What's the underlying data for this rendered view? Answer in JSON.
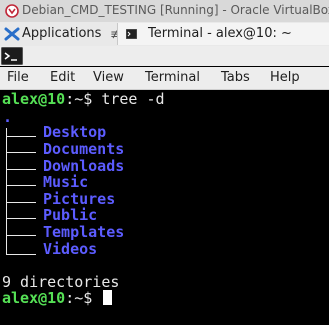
{
  "host_window": {
    "title": "Debian_CMD_TESTING [Running] - Oracle VirtualBox",
    "icon": "virtualbox-icon"
  },
  "guest_panel": {
    "applications_label": "Applications",
    "applications_separator": "≢",
    "task_label": "Terminal - alex@10: ~"
  },
  "terminal": {
    "menu": [
      "File",
      "Edit",
      "View",
      "Terminal",
      "Tabs",
      "Help"
    ],
    "prompt_user_host": "alex@10",
    "prompt_path": ":~$",
    "command": "tree -d",
    "root": ".",
    "directories": [
      "Desktop",
      "Documents",
      "Downloads",
      "Music",
      "Pictures",
      "Public",
      "Templates",
      "Videos"
    ],
    "summary": "9 directories"
  },
  "colors": {
    "prompt": "#55e055",
    "directory": "#5c5cff",
    "background": "#000000"
  }
}
